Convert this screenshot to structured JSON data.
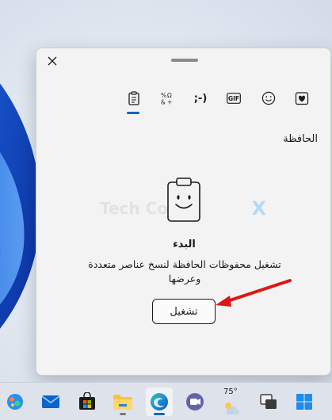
{
  "panel": {
    "close_icon": "close-icon",
    "tabs": [
      {
        "name": "clipboard",
        "icon": "clipboard-icon",
        "active": true
      },
      {
        "name": "symbols",
        "icon": "symbols-icon"
      },
      {
        "name": "kaomoji",
        "label": ";-)"
      },
      {
        "name": "gif",
        "label": "GIF"
      },
      {
        "name": "emoji",
        "icon": "emoji-icon"
      },
      {
        "name": "favorites",
        "icon": "heart-clipboard-icon"
      }
    ],
    "section_title": "الحافظة",
    "empty_state": {
      "title": "البدء",
      "description": "تشغيل محفوظات الحافظة لنسخ عناصر متعددة وعرضها",
      "button_label": "تشغيل"
    },
    "watermark": {
      "text": "Tech Co...",
      "mark": "X"
    },
    "accent_color": "#0067c0",
    "annotation_arrow_color": "#e01515"
  },
  "taskbar": {
    "items": [
      {
        "name": "widgets",
        "icon": "widgets-icon"
      },
      {
        "name": "mail",
        "icon": "mail-icon"
      },
      {
        "name": "store",
        "icon": "store-icon"
      },
      {
        "name": "file-explorer",
        "icon": "folder-icon"
      },
      {
        "name": "edge",
        "icon": "edge-icon"
      },
      {
        "name": "teams",
        "icon": "teams-icon"
      },
      {
        "name": "weather",
        "icon": "weather-icon",
        "temp": "75°"
      },
      {
        "name": "task-view",
        "icon": "task-view-icon"
      },
      {
        "name": "start",
        "icon": "windows-logo-icon"
      }
    ]
  }
}
